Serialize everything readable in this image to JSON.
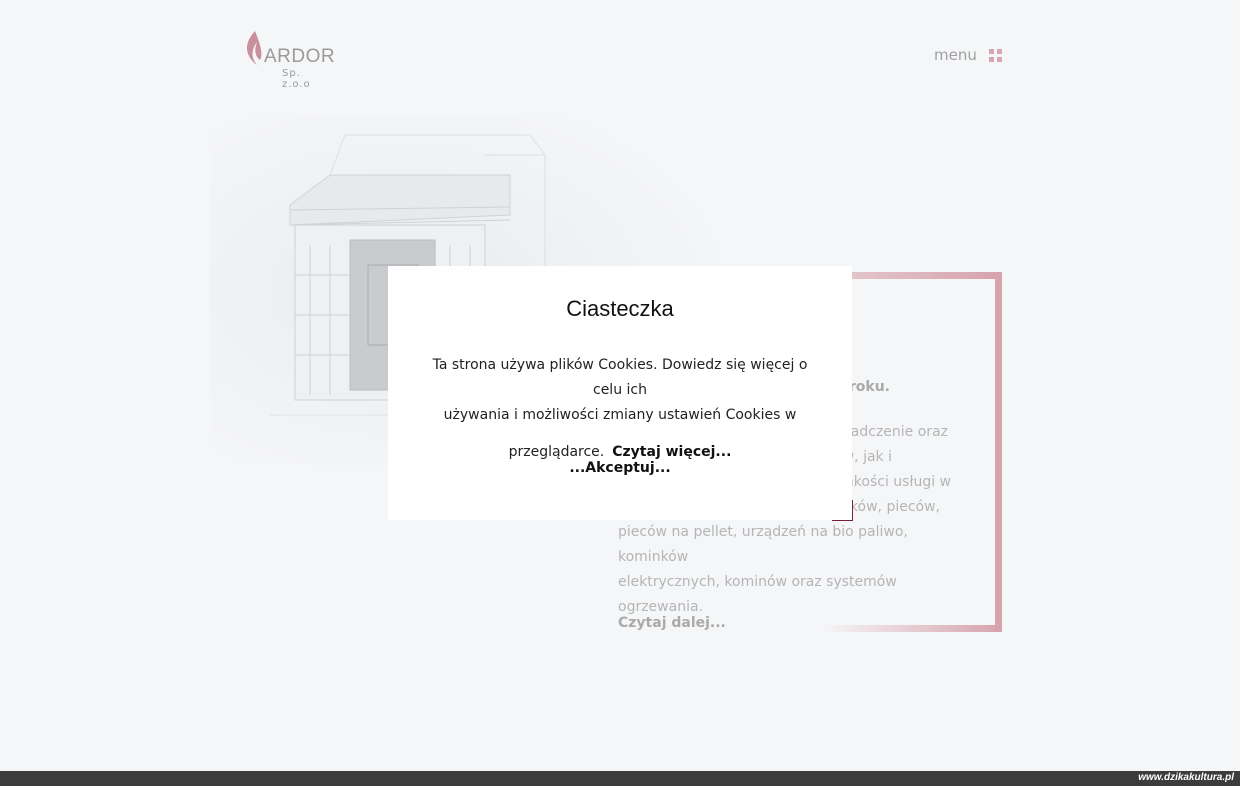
{
  "header": {
    "logo_name": "ARDOR",
    "logo_sub": "Sp. z.o.o",
    "menu_label": "menu"
  },
  "content": {
    "partial_bold": "roku.",
    "paragraph_lines": [
      "wiadczenie oraz",
      "w, jak i",
      "jakości usługi w",
      "nków, pieców,",
      "pieców na pellet, urządzeń na bio paliwo, kominków",
      "elektrycznych, kominów oraz systemów ogrzewania."
    ],
    "read_more": "Czytaj dalej..."
  },
  "cookie_modal": {
    "title": "Ciasteczka",
    "line1": "Ta strona używa plików Cookies. Dowiedz się więcej o celu ich",
    "line2": "używania i możliwości zmiany ustawień Cookies w",
    "line3": "przeglądarce.",
    "more_link": "Czytaj więcej...",
    "accept": "...Akceptuj..."
  },
  "footer": {
    "credit": "www.dzikakultura.pl"
  },
  "colors": {
    "accent": "#d7a3ad",
    "modal_corner": "#7a1d36",
    "background": "#f5f6f8"
  }
}
